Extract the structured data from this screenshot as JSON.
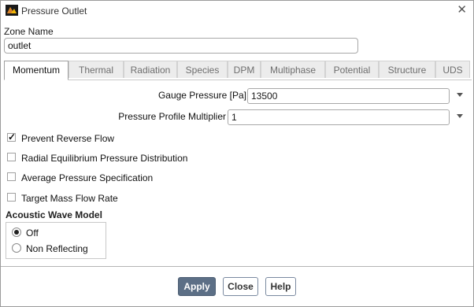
{
  "window": {
    "title": "Pressure Outlet",
    "close_symbol": "✕"
  },
  "zone": {
    "label": "Zone Name",
    "value": "outlet"
  },
  "tabs": [
    {
      "label": "Momentum",
      "active": true
    },
    {
      "label": "Thermal",
      "active": false
    },
    {
      "label": "Radiation",
      "active": false
    },
    {
      "label": "Species",
      "active": false
    },
    {
      "label": "DPM",
      "active": false
    },
    {
      "label": "Multiphase",
      "active": false
    },
    {
      "label": "Potential",
      "active": false
    },
    {
      "label": "Structure",
      "active": false
    },
    {
      "label": "UDS",
      "active": false
    }
  ],
  "momentum": {
    "gauge_pressure": {
      "label": "Gauge Pressure [Pa]",
      "value": "13500"
    },
    "profile_multiplier": {
      "label": "Pressure Profile Multiplier",
      "value": "1"
    },
    "checkboxes": [
      {
        "label": "Prevent Reverse Flow",
        "checked": true
      },
      {
        "label": "Radial Equilibrium Pressure Distribution",
        "checked": false
      },
      {
        "label": "Average Pressure Specification",
        "checked": false
      },
      {
        "label": "Target Mass Flow Rate",
        "checked": false
      }
    ],
    "acoustic": {
      "title": "Acoustic Wave Model",
      "options": [
        {
          "label": "Off",
          "selected": true
        },
        {
          "label": "Non Reflecting",
          "selected": false
        }
      ]
    }
  },
  "buttons": {
    "apply": "Apply",
    "close": "Close",
    "help": "Help"
  }
}
